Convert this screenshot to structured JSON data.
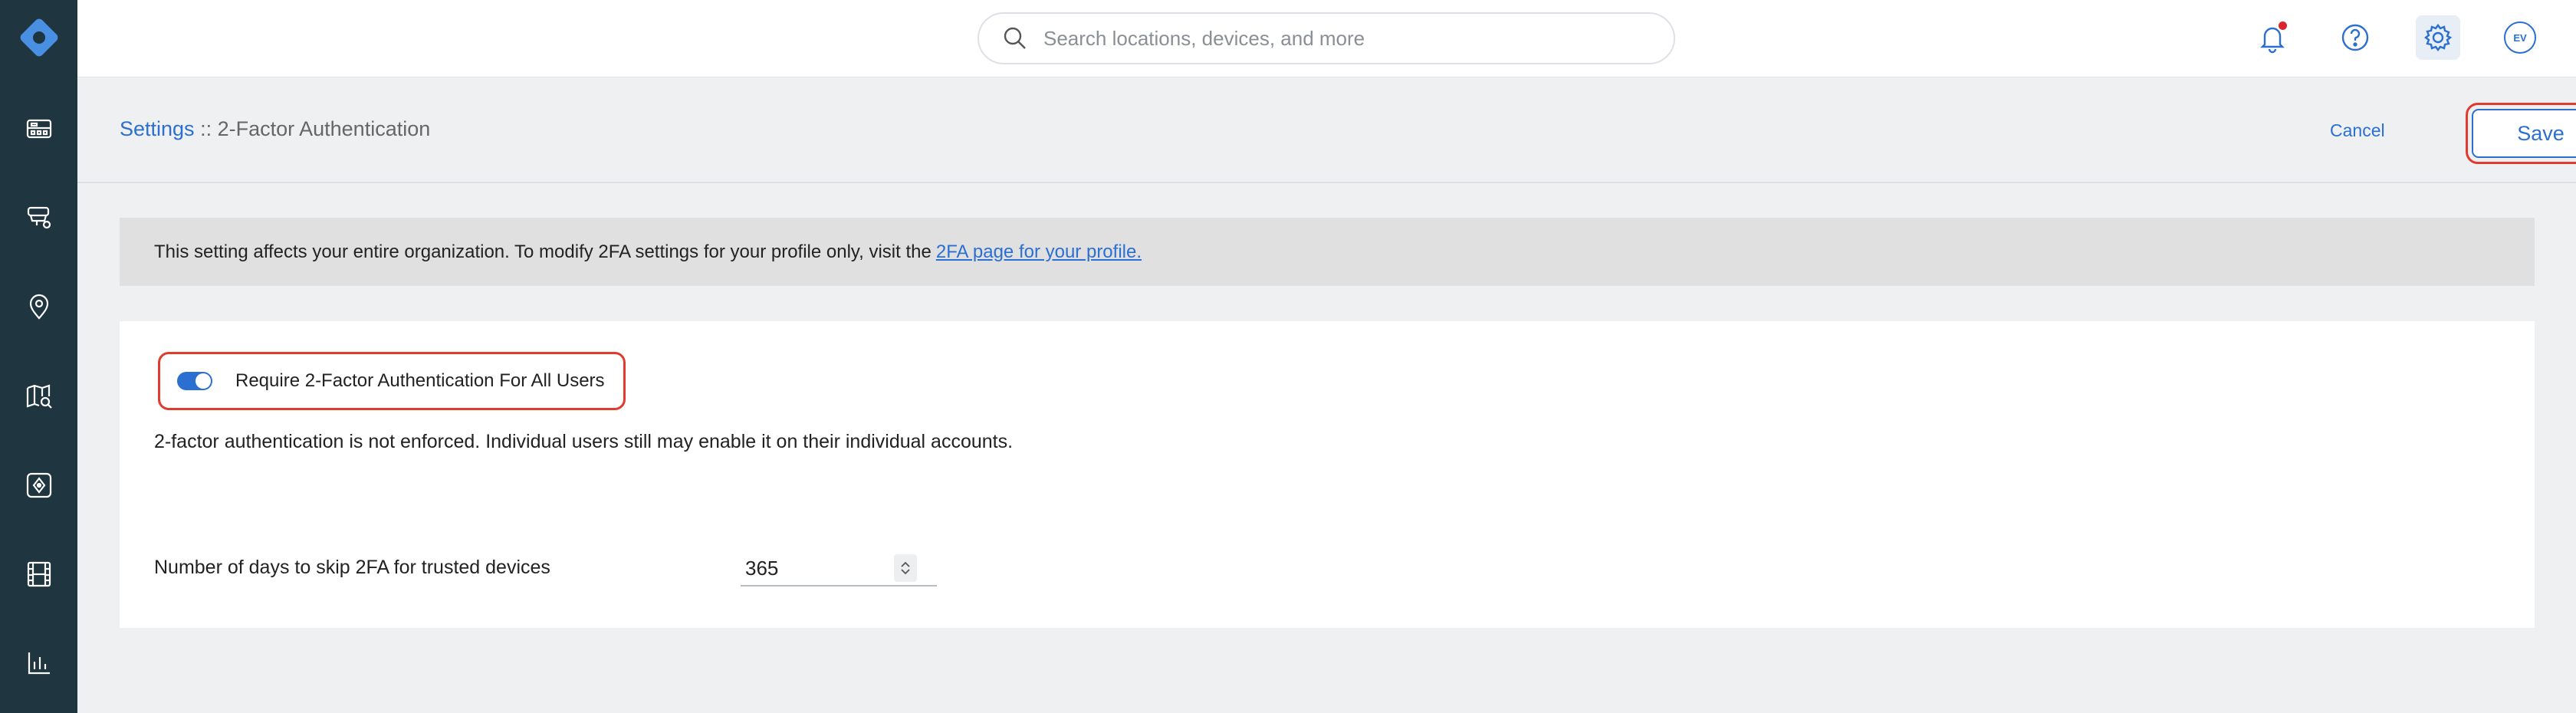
{
  "search": {
    "placeholder": "Search locations, devices, and more"
  },
  "user": {
    "initials": "EV"
  },
  "colors": {
    "accent": "#2b6fd1",
    "sidebar": "#1f3540",
    "highlight": "#e03b2e",
    "notification": "#d9262c"
  },
  "sidebar": {
    "items": [
      {
        "icon": "dashboard-icon"
      },
      {
        "icon": "devices-icon"
      },
      {
        "icon": "location-pin-icon"
      },
      {
        "icon": "map-search-icon"
      },
      {
        "icon": "integrations-icon"
      },
      {
        "icon": "video-film-icon"
      },
      {
        "icon": "reports-chart-icon"
      }
    ]
  },
  "header": {
    "breadcrumb_root": "Settings",
    "breadcrumb_separator": " :: ",
    "breadcrumb_current": "2-Factor Authentication",
    "cancel_label": "Cancel",
    "save_label": "Save"
  },
  "notice": {
    "text": "This setting affects your entire organization. To modify 2FA settings for your profile only, visit the",
    "link_text": "2FA page for your profile."
  },
  "settings": {
    "require_2fa_label": "Require 2-Factor Authentication For All Users",
    "require_2fa_enabled": true,
    "enforcement_status": "2-factor authentication is not enforced. Individual users still may enable it on their individual accounts.",
    "trusted_days_label": "Number of days to skip 2FA for trusted devices",
    "trusted_days_value": "365"
  }
}
